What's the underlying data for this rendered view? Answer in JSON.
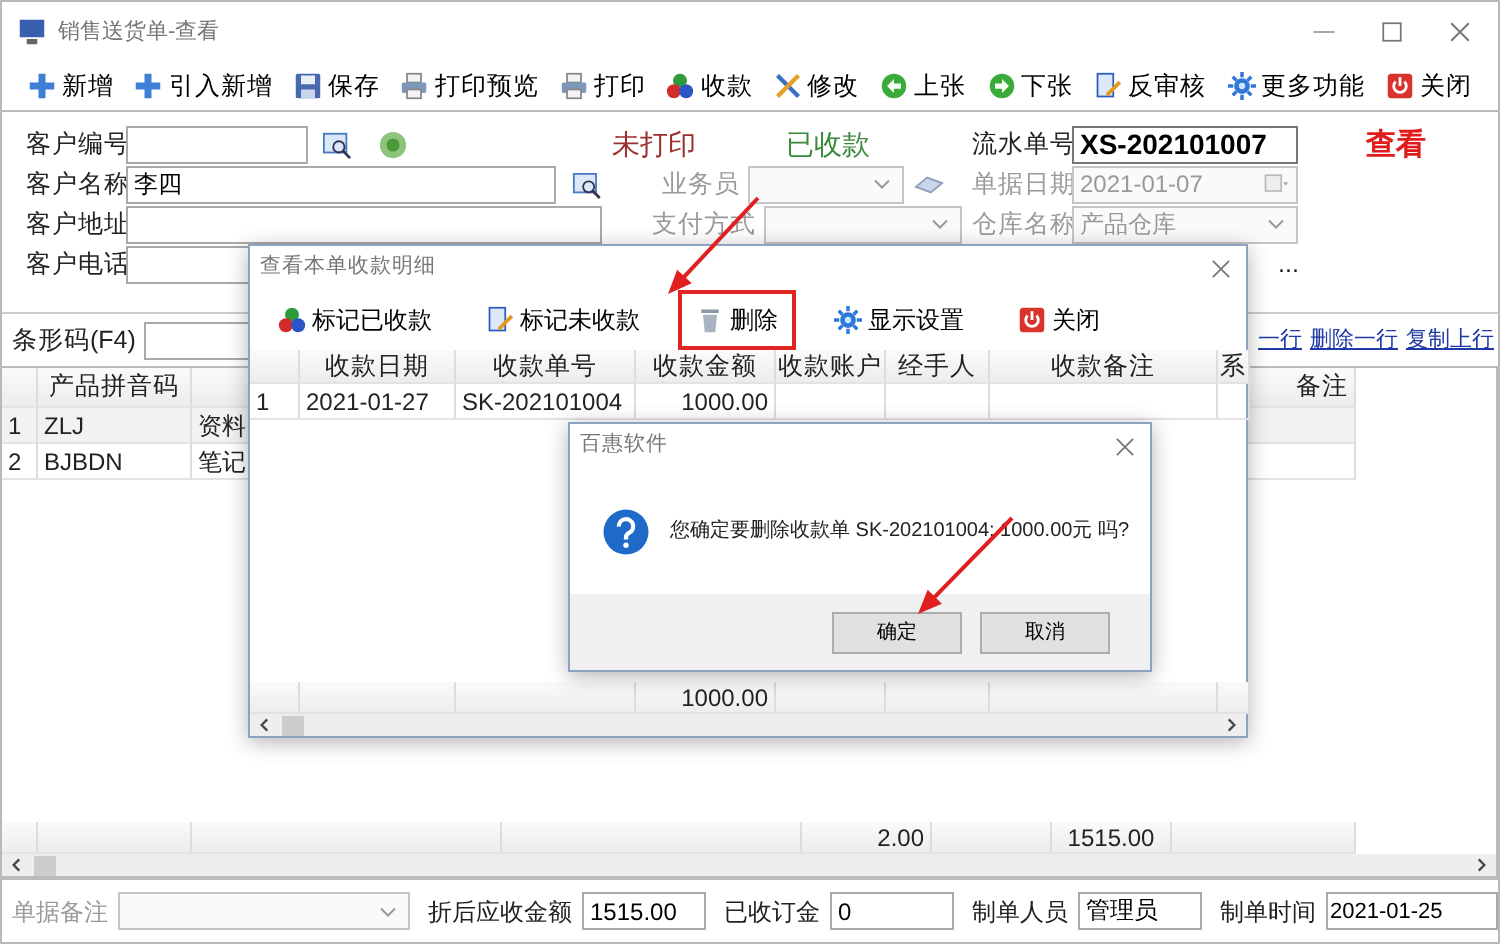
{
  "window": {
    "title": "销售送货单-查看"
  },
  "toolbar": [
    {
      "label": "新增",
      "kind": "plus"
    },
    {
      "label": "引入新增",
      "kind": "plus"
    },
    {
      "label": "保存",
      "kind": "save"
    },
    {
      "label": "打印预览",
      "kind": "printer"
    },
    {
      "label": "打印",
      "kind": "printer"
    },
    {
      "label": "收款",
      "kind": "balls"
    },
    {
      "label": "修改",
      "kind": "tools"
    },
    {
      "label": "上张",
      "kind": "left"
    },
    {
      "label": "下张",
      "kind": "right"
    },
    {
      "label": "反审核",
      "kind": "edit"
    },
    {
      "label": "更多功能",
      "kind": "gear"
    },
    {
      "label": "关闭",
      "kind": "power"
    }
  ],
  "customer_fields": [
    {
      "label": "客户编号",
      "kind": "lookup"
    },
    {
      "label": "客户名称",
      "value": "李四",
      "kind": "search"
    },
    {
      "label": "客户地址",
      "kind": "text"
    },
    {
      "label": "客户电话",
      "kind": "text"
    }
  ],
  "print_status": "未打印",
  "payment_status": "已收款",
  "middle_fields": [
    {
      "label": "业务员",
      "kind": "select",
      "disabled": true
    },
    {
      "label": "支付方式",
      "kind": "select",
      "disabled": true
    }
  ],
  "doc_fields": [
    {
      "label": "流水单号",
      "value": "XS-202101007",
      "kind": "text",
      "bold": true
    },
    {
      "label": "单据日期",
      "value": "2021-01-07",
      "kind": "date",
      "disabled": true
    },
    {
      "label": "仓库名称",
      "value": "产品仓库",
      "kind": "select",
      "disabled": true
    }
  ],
  "mode_label": "查看",
  "more_text": "...",
  "barcode": {
    "label": "条形码(F4)"
  },
  "row_actions": [
    "一行",
    "删除一行",
    "复制上行"
  ],
  "items_table": {
    "columns": [
      {
        "label": "产品拼音码"
      },
      {
        "label": "备注"
      }
    ],
    "rows": [
      {
        "index": "1",
        "code": "ZLJ",
        "name": "资料"
      },
      {
        "index": "2",
        "code": "BJBDN",
        "name": "笔记"
      }
    ],
    "totals": {
      "quantity": "2.00",
      "amount": "1515.00"
    }
  },
  "footer_fields": [
    {
      "label": "单据备注",
      "kind": "select",
      "disabled": true
    },
    {
      "label": "折后应收金额",
      "value": "1515.00",
      "kind": "text"
    },
    {
      "label": "已收订金",
      "value": "0",
      "kind": "text"
    },
    {
      "label": "制单人员",
      "value": "管理员",
      "kind": "text"
    },
    {
      "label": "制单时间",
      "value": "2021-01-25",
      "kind": "text"
    }
  ],
  "receipts_dialog": {
    "title": "查看本单收款明细",
    "toolbar": [
      {
        "label": "标记已收款",
        "kind": "balls",
        "highlighted": false
      },
      {
        "label": "标记未收款",
        "kind": "edit",
        "highlighted": false
      },
      {
        "label": "删除",
        "kind": "trash",
        "highlighted": true
      },
      {
        "label": "显示设置",
        "kind": "gear",
        "highlighted": false
      },
      {
        "label": "关闭",
        "kind": "power",
        "highlighted": false
      }
    ],
    "columns": [
      {
        "label": "收款日期"
      },
      {
        "label": "收款单号"
      },
      {
        "label": "收款金额"
      },
      {
        "label": "收款账户"
      },
      {
        "label": "经手人"
      },
      {
        "label": "收款备注"
      },
      {
        "label": "系"
      }
    ],
    "rows": [
      {
        "index": "1",
        "cells": [
          "2021-01-27",
          "SK-202101004",
          "1000.00"
        ]
      }
    ],
    "total": "1000.00"
  },
  "confirm_dialog": {
    "title": "百惠软件",
    "message": "您确定要删除收款单 SK-202101004; 1000.00元 吗?",
    "buttons": [
      {
        "label": "确定"
      },
      {
        "label": "取消"
      }
    ]
  },
  "annotations": [
    {
      "kind": "arrow"
    },
    {
      "kind": "arrow"
    }
  ]
}
